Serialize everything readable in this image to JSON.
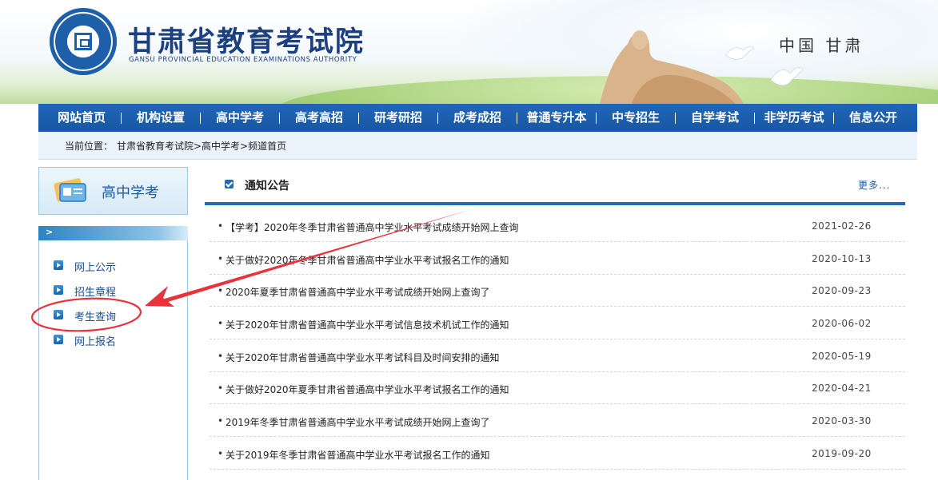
{
  "header": {
    "title": "甘肃省教育考试院",
    "subtitle": "GANSU PROVINCIAL EDUCATION EXAMINATIONS AUTHORITY",
    "region": "中国 甘肃"
  },
  "nav": {
    "items": [
      "网站首页",
      "机构设置",
      "高中学考",
      "高考高招",
      "研考研招",
      "成考成招",
      "普通专升本",
      "中专招生",
      "自学考试",
      "非学历考试",
      "信息公开"
    ]
  },
  "breadcrumb": {
    "label": "当前位置：",
    "path": "甘肃省教育考试院>高中学考>频道首页"
  },
  "sidebar": {
    "title": "高中学考",
    "bar_arrow": ">",
    "links": [
      "网上公示",
      "招生章程",
      "考生查询",
      "网上报名"
    ]
  },
  "notices": {
    "title": "通知公告",
    "more": "更多...",
    "bullet": "•",
    "items": [
      {
        "title": "【学考】2020年冬季甘肃省普通高中学业水平考试成绩开始网上查询",
        "date": "2021-02-26"
      },
      {
        "title": "关于做好2020年冬季甘肃省普通高中学业水平考试报名工作的通知",
        "date": "2020-10-13"
      },
      {
        "title": "2020年夏季甘肃省普通高中学业水平考试成绩开始网上查询了",
        "date": "2020-09-23"
      },
      {
        "title": "关于2020年甘肃省普通高中学业水平考试信息技术机试工作的通知",
        "date": "2020-06-02"
      },
      {
        "title": "关于2020年甘肃省普通高中学业水平考试科目及时间安排的通知",
        "date": "2020-05-19"
      },
      {
        "title": "关于做好2020年夏季甘肃省普通高中学业水平考试报名工作的通知",
        "date": "2020-04-21"
      },
      {
        "title": "2019年冬季甘肃省普通高中学业水平考试成绩开始网上查询了",
        "date": "2020-03-30"
      },
      {
        "title": "关于2019年冬季甘肃省普通高中学业水平考试报名工作的通知",
        "date": "2019-09-20"
      }
    ]
  },
  "colors": {
    "nav_blue": "#1857a3",
    "annotation_red": "#e8323c"
  }
}
